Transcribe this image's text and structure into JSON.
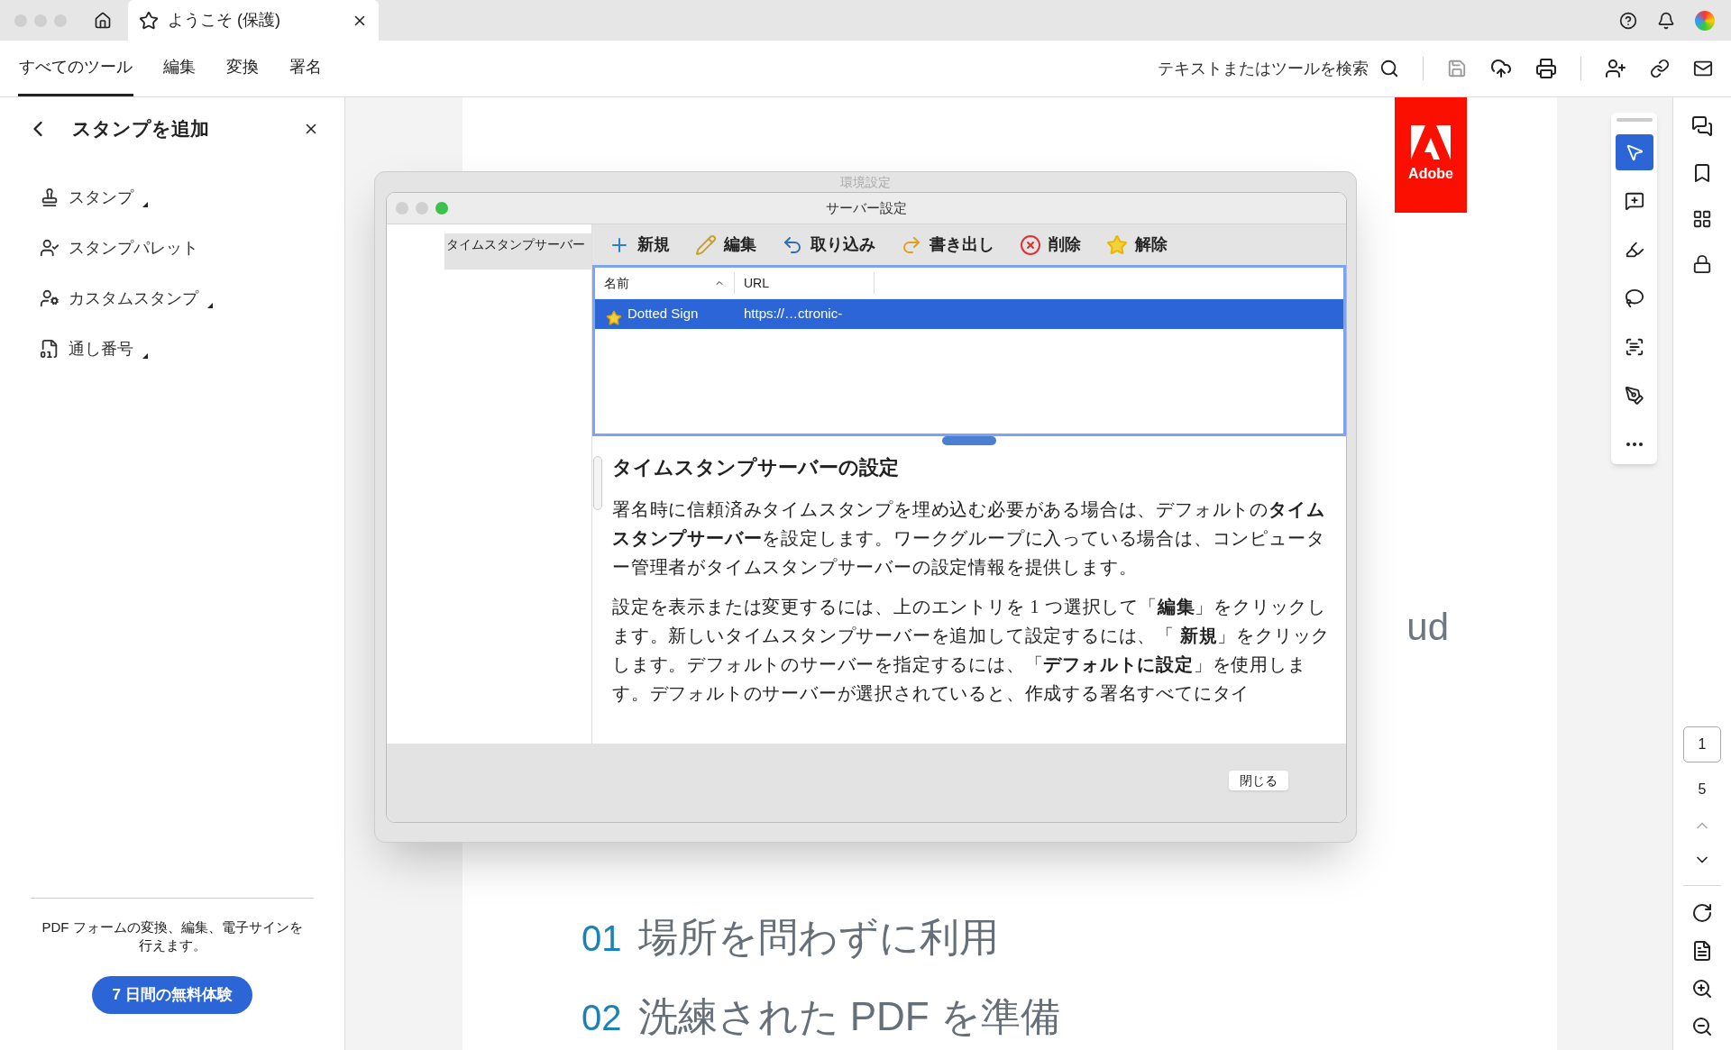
{
  "browser_tab": {
    "title": "ようこそ (保護)"
  },
  "menu_tabs": [
    {
      "label": "すべてのツール",
      "selected": true
    },
    {
      "label": "編集",
      "selected": false
    },
    {
      "label": "変換",
      "selected": false
    },
    {
      "label": "署名",
      "selected": false
    }
  ],
  "search": {
    "placeholder": "テキストまたはツールを検索"
  },
  "panel": {
    "title": "スタンプを追加",
    "items": [
      {
        "kind": "stamp",
        "label": "スタンプ",
        "submenu": true
      },
      {
        "kind": "palette",
        "label": "スタンプパレット",
        "submenu": false
      },
      {
        "kind": "custom",
        "label": "カスタムスタンプ",
        "submenu": true
      },
      {
        "kind": "number",
        "label": "通し番号",
        "submenu": true
      }
    ],
    "promo": "PDF フォームの変換、編集、電子サインを行えます。",
    "trial_button": "7 日間の無料体験"
  },
  "document": {
    "logo": "Adobe",
    "fragment": "ud",
    "list": [
      {
        "number": "01",
        "text": "場所を問わずに利用"
      },
      {
        "number": "02",
        "text": "洗練された PDF を準備"
      }
    ]
  },
  "background_window": {
    "title": "環境設定"
  },
  "dialog": {
    "title": "サーバー設定",
    "categories": [
      {
        "label": "タイムスタンプサーバー",
        "selected": true
      }
    ],
    "toolbar": [
      {
        "kind": "new",
        "label": "新規"
      },
      {
        "kind": "edit",
        "label": "編集"
      },
      {
        "kind": "import",
        "label": "取り込み"
      },
      {
        "kind": "export",
        "label": "書き出し"
      },
      {
        "kind": "delete",
        "label": "削除"
      },
      {
        "kind": "unset",
        "label": "解除"
      }
    ],
    "columns": [
      "名前",
      "URL"
    ],
    "rows": [
      {
        "name": "Dotted Sign",
        "url": "https://…ctronic-",
        "default": true,
        "selected": true
      }
    ],
    "help": {
      "heading": "タイムスタンプサーバーの設定",
      "paragraphs": [
        "署名時に信頼済みタイムスタンプを埋め込む必要がある場合は、デフォルトの**タイムスタンプサーバー**を設定します。ワークグループに入っている場合は、コンピューター管理者がタイムスタンプサーバーの設定情報を提供します。",
        "設定を表示または変更するには、上のエントリを 1 つ選択して「**編集**」をクリックします。新しいタイムスタンプサーバーを追加して設定するには、「 **新規**」をクリックします。デフォルトのサーバーを指定するには、「**デフォルトに設定**」を使用します。デフォルトのサーバーが選択されていると、作成する署名すべてにタイ"
      ]
    },
    "close_button": "閉じる"
  },
  "tools": [
    {
      "kind": "select",
      "selected": true
    },
    {
      "kind": "comment",
      "selected": false
    },
    {
      "kind": "highlight",
      "selected": false
    },
    {
      "kind": "lasso",
      "selected": false
    },
    {
      "kind": "text",
      "selected": false
    },
    {
      "kind": "sign",
      "selected": false
    },
    {
      "kind": "more",
      "selected": false
    }
  ],
  "page_nav": {
    "current": "1",
    "total": "5"
  }
}
